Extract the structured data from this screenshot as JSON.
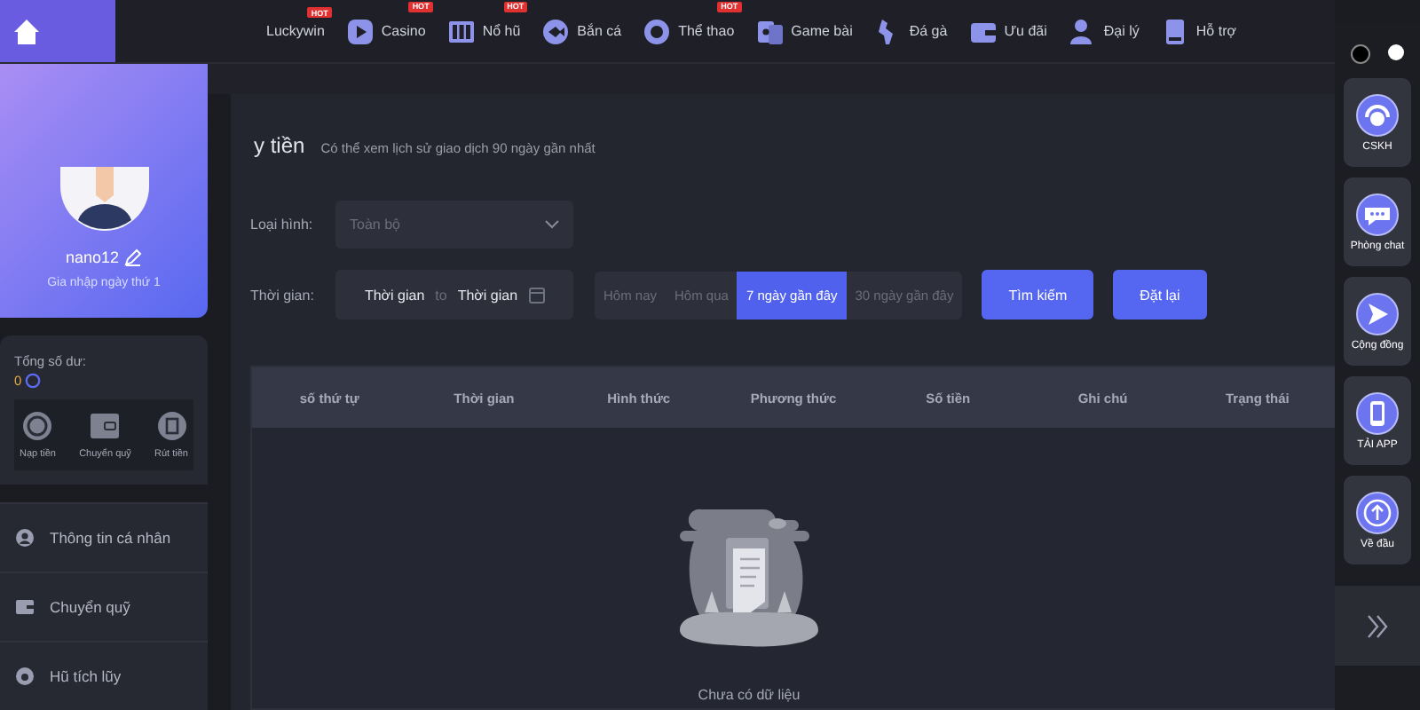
{
  "nav": {
    "items": [
      {
        "label": "Luckywin",
        "badge": "HOT"
      },
      {
        "label": "Casino",
        "badge": "HOT"
      },
      {
        "label": "Nổ hũ",
        "badge": "HOT"
      },
      {
        "label": "Bắn cá"
      },
      {
        "label": "Thể thao",
        "badge": "HOT"
      },
      {
        "label": "Game bài"
      },
      {
        "label": "Đá gà"
      },
      {
        "label": "Ưu đãi"
      },
      {
        "label": "Đại lý"
      },
      {
        "label": "Hỗ trợ"
      }
    ]
  },
  "profile": {
    "username": "nano12",
    "joined": "Gia nhập ngày thứ 1"
  },
  "balance": {
    "label": "Tổng số dư:",
    "amount": "0",
    "actions": [
      "Nạp tiền",
      "Chuyển quỹ",
      "Rút tiền"
    ]
  },
  "menu": [
    "Thông tin cá nhân",
    "Chuyển quỹ",
    "Hũ tích lũy"
  ],
  "page": {
    "title": "y tiền",
    "subtitle": "Có thể xem lịch sử giao dịch 90 ngày gần nhất"
  },
  "filters": {
    "type_label": "Loại hình:",
    "type_value": "Toàn bộ",
    "time_label": "Thời gian:",
    "start": "Thời gian",
    "separator": "to",
    "end": "Thời gian",
    "ranges": [
      {
        "label": "Hôm nay",
        "selected": false
      },
      {
        "label": "Hôm qua",
        "selected": false
      },
      {
        "label": "7 ngày gần đây",
        "selected": true
      },
      {
        "label": "30 ngày gần đây",
        "selected": false
      }
    ],
    "buttons": [
      "Tìm kiếm",
      "Đặt lại"
    ]
  },
  "table": {
    "columns": [
      "số thứ tự",
      "Thời gian",
      "Hình thức",
      "Phương thức",
      "Số tiền",
      "Ghi chú",
      "Trạng thái"
    ],
    "empty_text": "Chưa có dữ liệu"
  },
  "side_rail": {
    "items": [
      {
        "kind": "headset",
        "label": "CSKH"
      },
      {
        "kind": "chat",
        "label": "Phòng chat"
      },
      {
        "kind": "send",
        "label": "Cộng đồng"
      },
      {
        "kind": "phone",
        "label": "TẢI APP"
      },
      {
        "kind": "up",
        "label": "Về đầu"
      }
    ]
  }
}
